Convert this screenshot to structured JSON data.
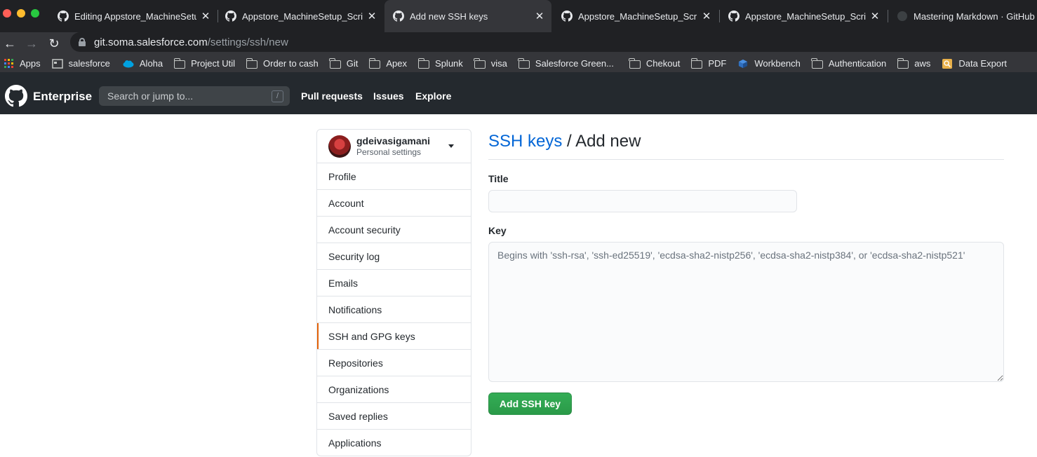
{
  "browser": {
    "tabs": [
      {
        "title": "Editing Appstore_MachineSetup_Scripts",
        "active": false
      },
      {
        "title": "Appstore_MachineSetup_Scripts",
        "active": false
      },
      {
        "title": "Add new SSH keys",
        "active": true
      },
      {
        "title": "Appstore_MachineSetup_Scripts",
        "active": false
      },
      {
        "title": "Appstore_MachineSetup_Scripts",
        "active": false
      },
      {
        "title": "Mastering Markdown · GitHub Guides",
        "active": false
      }
    ],
    "url_host": "git.soma.salesforce.com",
    "url_path": "/settings/ssh/new",
    "bookmarks": [
      {
        "label": "Apps",
        "icon": "apps-grid-icon"
      },
      {
        "label": "salesforce",
        "icon": "page-icon"
      },
      {
        "label": "Aloha",
        "icon": "salesforce-cloud-icon"
      },
      {
        "label": "Project Util",
        "icon": "folder-icon"
      },
      {
        "label": "Order to cash",
        "icon": "folder-icon"
      },
      {
        "label": "Git",
        "icon": "folder-icon"
      },
      {
        "label": "Apex",
        "icon": "folder-icon"
      },
      {
        "label": "Splunk",
        "icon": "folder-icon"
      },
      {
        "label": "visa",
        "icon": "folder-icon"
      },
      {
        "label": "Salesforce Green...",
        "icon": "folder-icon"
      },
      {
        "label": "Chekout",
        "icon": "folder-icon"
      },
      {
        "label": "PDF",
        "icon": "folder-icon"
      },
      {
        "label": "Workbench",
        "icon": "cube-icon"
      },
      {
        "label": "Authentication",
        "icon": "folder-icon"
      },
      {
        "label": "aws",
        "icon": "folder-icon"
      },
      {
        "label": "Data Export",
        "icon": "data-export-icon"
      }
    ]
  },
  "header": {
    "brand": "Enterprise",
    "search_placeholder": "Search or jump to...",
    "search_shortcut": "/",
    "nav": [
      "Pull requests",
      "Issues",
      "Explore"
    ]
  },
  "sidebar": {
    "username": "gdeivasigamani",
    "subtitle": "Personal settings",
    "items": [
      {
        "label": "Profile",
        "selected": false
      },
      {
        "label": "Account",
        "selected": false
      },
      {
        "label": "Account security",
        "selected": false
      },
      {
        "label": "Security log",
        "selected": false
      },
      {
        "label": "Emails",
        "selected": false
      },
      {
        "label": "Notifications",
        "selected": false
      },
      {
        "label": "SSH and GPG keys",
        "selected": true
      },
      {
        "label": "Repositories",
        "selected": false
      },
      {
        "label": "Organizations",
        "selected": false
      },
      {
        "label": "Saved replies",
        "selected": false
      },
      {
        "label": "Applications",
        "selected": false
      }
    ]
  },
  "main": {
    "breadcrumb_link": "SSH keys",
    "breadcrumb_separator": " / ",
    "breadcrumb_current": "Add new",
    "title_label": "Title",
    "title_value": "",
    "key_label": "Key",
    "key_placeholder": "Begins with 'ssh-rsa', 'ssh-ed25519', 'ecdsa-sha2-nistp256', 'ecdsa-sha2-nistp384', or 'ecdsa-sha2-nistp521'",
    "submit_label": "Add SSH key"
  },
  "colors": {
    "header_bg": "#24292e",
    "link": "#0366d6",
    "primary_button": "#2ea44f",
    "selected_indicator": "#e36209"
  }
}
